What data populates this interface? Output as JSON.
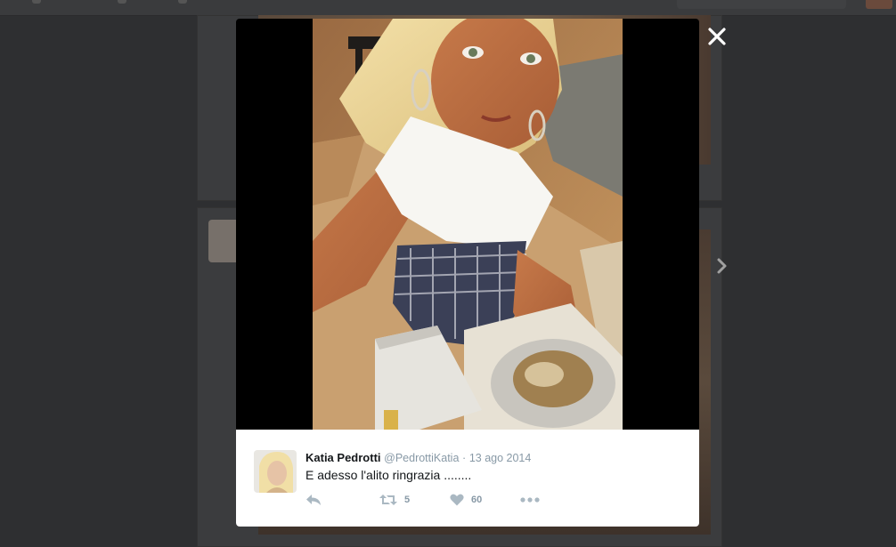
{
  "tweet": {
    "name": "Katia Pedrotti",
    "handle": "@PedrottiKatia",
    "separator": "·",
    "date": "13 ago 2014",
    "text": "E adesso l'alito ringrazia ........",
    "retweet_count": "5",
    "like_count": "60"
  },
  "icons": {
    "close": "close-icon",
    "next": "chevron-right-icon",
    "reply": "reply-icon",
    "retweet": "retweet-icon",
    "like": "heart-icon",
    "more": "more-icon"
  },
  "colors": {
    "overlay": "#2e2f31",
    "modal_bg": "#000000",
    "tweet_bg": "#ffffff",
    "name": "#14171a",
    "meta": "#8899a6",
    "icon": "#aab8c2"
  }
}
